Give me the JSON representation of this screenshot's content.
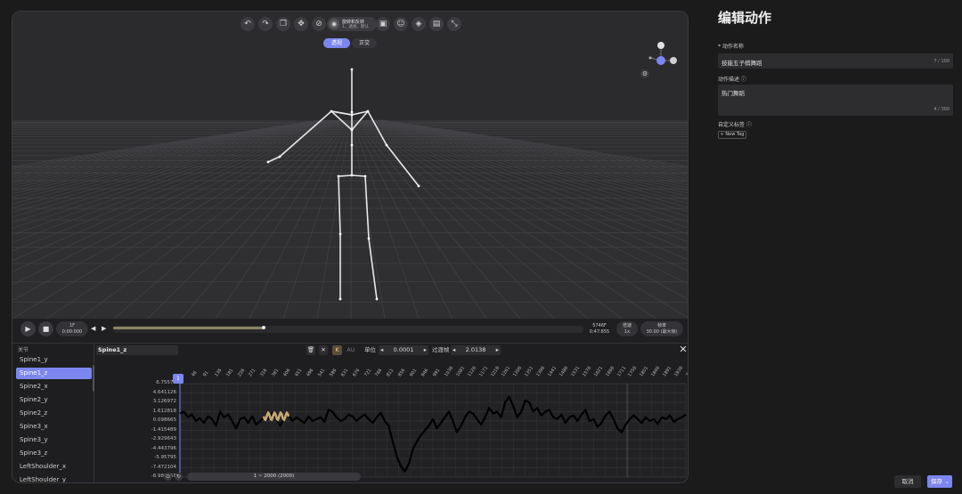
{
  "toolbar": {
    "icons": [
      "undo-icon",
      "redo-icon",
      "copy-icon",
      "move-icon",
      "hide-icon",
      "camera-icon",
      "image-icon",
      "face-scan-icon",
      "layers-icon",
      "save-icon",
      "collapse-icon"
    ],
    "mode_title": "旋转和反转",
    "mode_sub": "1、透视、默认"
  },
  "view_toggle": {
    "perspective": "透视",
    "ortho": "正交"
  },
  "playback": {
    "frame_start": "1F",
    "time_start": "0:00:000",
    "frame_end": "5746F",
    "time_end": "0:47:855",
    "speed_label": "倍速",
    "speed_value": "1x",
    "fps_label": "帧率",
    "fps_value": "30.00 (最大帧)",
    "progress": 0.32
  },
  "curve_editor": {
    "list_header": "关节",
    "bones": [
      "Spine1_y",
      "Spine1_z",
      "Spine2_x",
      "Spine2_y",
      "Spine2_z",
      "Spine3_x",
      "Spine3_y",
      "Spine3_z",
      "LeftShoulder_x",
      "LeftShoulder_y"
    ],
    "selected_index": 1,
    "selected_name": "Spine1_z",
    "unit_label": "单位",
    "unit_value": "0.0001",
    "trans_label": "过渡帧",
    "trans_value": "2.0138",
    "kbtn": "K",
    "aubtn": "AU",
    "playhead_frame": "1",
    "range_label": "1 ~ 2000 (2000)",
    "y_ticks": [
      "6.75574",
      "4.641126",
      "3.126972",
      "1.612818",
      "0.098665",
      "-1.415489",
      "-2.929643",
      "-4.443796",
      "-5.95795",
      "-7.472104",
      "-8.986258"
    ],
    "x_ticks": [
      "1",
      "46",
      "91",
      "136",
      "181",
      "226",
      "271",
      "316",
      "361",
      "406",
      "451",
      "496",
      "541",
      "586",
      "631",
      "676",
      "721",
      "766",
      "811",
      "856",
      "901",
      "946",
      "991",
      "1036",
      "1081",
      "1126",
      "1171",
      "1216",
      "1261",
      "1306",
      "1351",
      "1396",
      "1441",
      "1486",
      "1531",
      "1576",
      "1621",
      "1666",
      "1711",
      "1756",
      "1801",
      "1846",
      "1891",
      "1936",
      "2000"
    ]
  },
  "panel": {
    "title": "编辑动作",
    "name_label": "* 动作名称",
    "name_value": "技能五子棋舞蹈",
    "name_count": "7 / 100",
    "desc_label": "动作描述 ⓘ",
    "desc_value": "热门舞蹈",
    "desc_count": "4 / 300",
    "tag_label": "自定义标签 ⓘ",
    "new_tag": "+ New Tag",
    "cancel": "取消",
    "save": "保存"
  },
  "colors": {
    "accent": "#7c86f0",
    "curve": "#000000",
    "curve_highlight": "#c8a872",
    "bg": "#1b1b1c"
  }
}
